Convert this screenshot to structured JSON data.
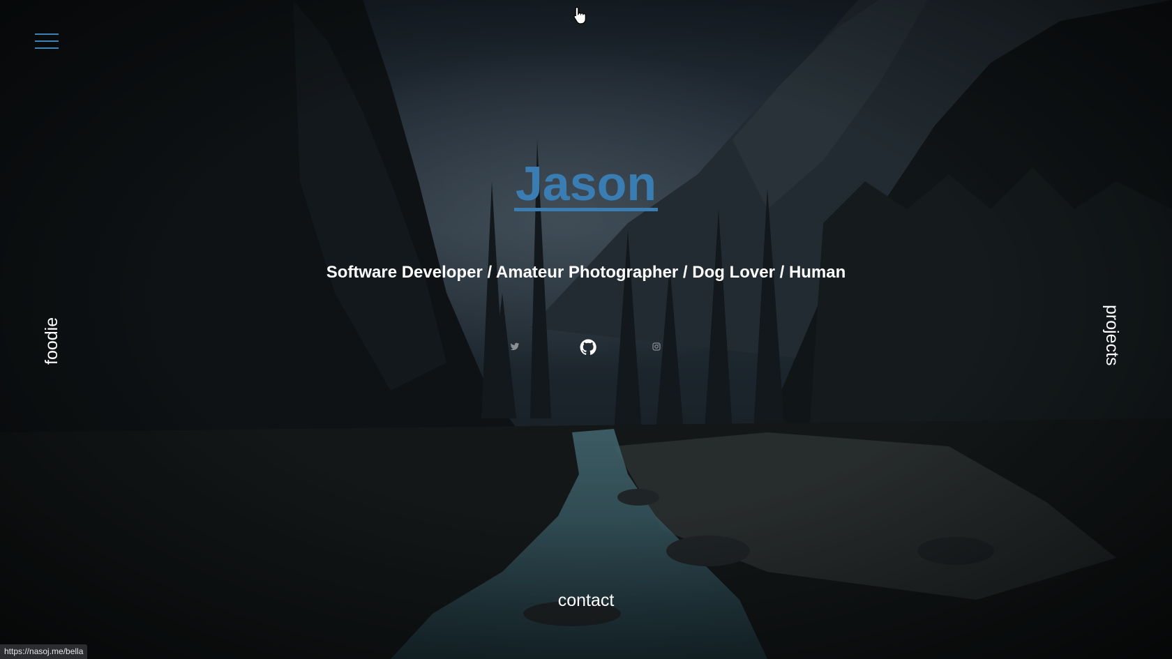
{
  "hero": {
    "name": "Jason",
    "tagline": "Software Developer / Amateur Photographer / Dog Lover / Human"
  },
  "nav": {
    "left_link": "foodie",
    "right_link": "projects",
    "bottom_link": "contact"
  },
  "social": {
    "icons": [
      "twitter-icon",
      "github-icon",
      "instagram-icon"
    ]
  },
  "status_bar": {
    "url": "https://nasoj.me/bella"
  },
  "colors": {
    "accent": "#3a7db3",
    "text": "#ffffff",
    "background": "#111417"
  }
}
